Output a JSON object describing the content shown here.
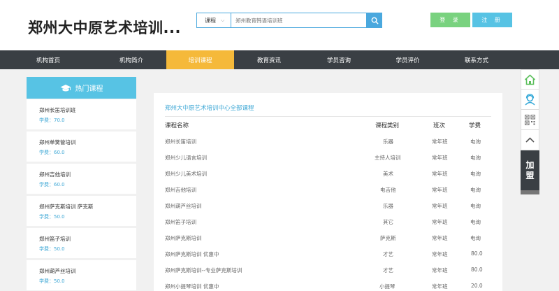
{
  "header": {
    "site_title": "郑州大中原艺术培训...",
    "search_category": "课程",
    "search_placeholder": "郑州教育韩语培训班",
    "login_label": "登 录",
    "register_label": "注 册"
  },
  "nav": {
    "items": [
      {
        "label": "机构首页"
      },
      {
        "label": "机构简介"
      },
      {
        "label": "培训课程"
      },
      {
        "label": "教育资讯"
      },
      {
        "label": "学员咨询"
      },
      {
        "label": "学员评价"
      },
      {
        "label": "联系方式"
      }
    ],
    "active_index": 2
  },
  "sidebar": {
    "title": "热门课程",
    "items": [
      {
        "name": "郑州长笛培训班",
        "price": "学费：70.0"
      },
      {
        "name": "郑州单簧管培训",
        "price": "学费：60.0"
      },
      {
        "name": "郑州吉他培训",
        "price": "学费：60.0"
      },
      {
        "name": "郑州萨克斯培训 萨克斯",
        "price": "学费：50.0"
      },
      {
        "name": "郑州笛子培训",
        "price": "学费：50.0"
      },
      {
        "name": "郑州葫芦丝培训",
        "price": "学费：50.0"
      }
    ]
  },
  "panel": {
    "title": "郑州大中原艺术培训中心全部课程",
    "columns": [
      "课程名称",
      "课程类别",
      "班次",
      "学费"
    ],
    "rows": [
      [
        "郑州长笛培训",
        "乐器",
        "常年班",
        "电询"
      ],
      [
        "郑州少儿语言培训",
        "主持人培训",
        "常年班",
        "电询"
      ],
      [
        "郑州少儿美术培训",
        "美术",
        "常年班",
        "电询"
      ],
      [
        "郑州吉他培训",
        "电吉他",
        "常年班",
        "电询"
      ],
      [
        "郑州葫芦丝培训",
        "乐器",
        "常年班",
        "电询"
      ],
      [
        "郑州笛子培训",
        "其它",
        "常年班",
        "电询"
      ],
      [
        "郑州萨克斯培训",
        "萨克斯",
        "常年班",
        "电询"
      ],
      [
        "郑州萨克斯培训 优惠中",
        "才艺",
        "常年班",
        "80.0"
      ],
      [
        "郑州萨克斯培训--专业萨克斯培训",
        "才艺",
        "常年班",
        "80.0"
      ],
      [
        "郑州小提琴培训 优惠中",
        "小提琴",
        "常年班",
        "20.0"
      ]
    ]
  },
  "rightbar": {
    "join_label_1": "加",
    "join_label_2": "盟"
  },
  "colors": {
    "nav_bg": "#3a3f44",
    "nav_active": "#f5b93a",
    "accent_blue": "#57c3e4",
    "login_green": "#79d27f"
  }
}
